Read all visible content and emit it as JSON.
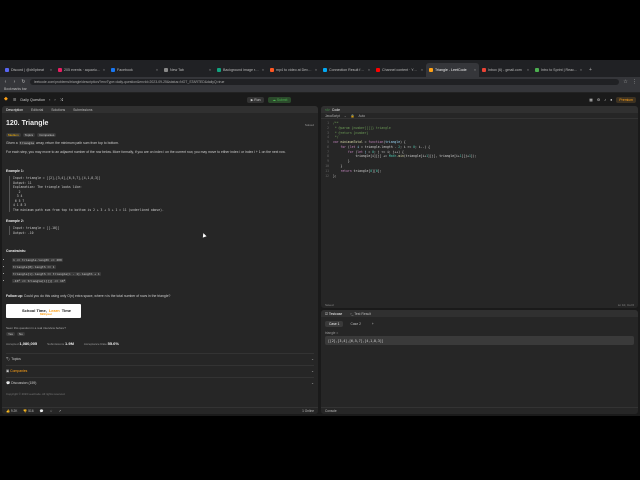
{
  "browser": {
    "tabs": [
      {
        "label": "Discord | @dr0pbeat",
        "color": "#5865f2",
        "active": false
      },
      {
        "label": "205 events · aquarius | Fr...",
        "color": "#e91e63",
        "active": false
      },
      {
        "label": "Facebook",
        "color": "#1877f2",
        "active": false
      },
      {
        "label": "New Tab",
        "color": "#888888",
        "active": false
      },
      {
        "label": "Background image request",
        "color": "#10a37f",
        "active": false
      },
      {
        "label": "mp4 to video at DevSkills5",
        "color": "#ff5722",
        "active": false
      },
      {
        "label": "Connection Result for #Wi...",
        "color": "#03a9f4",
        "active": false
      },
      {
        "label": "Channel content · YouTube",
        "color": "#ff0000",
        "active": false
      },
      {
        "label": "Triangle - LeetCode",
        "color": "#ffa116",
        "active": true
      },
      {
        "label": "Inbox (6) - gmail.com",
        "color": "#ea4335",
        "active": false
      },
      {
        "label": "Intro to Sprint | ReactJobs",
        "color": "#4caf50",
        "active": false
      }
    ],
    "url": "leetcode.com/problems/triangle/description/?envType=daily-question&envId=2023-09-25&status=NOT_STARTED&dailyQ=true",
    "bookmarks": [
      "Bookmarks bar"
    ]
  },
  "header": {
    "daily_label": "Daily Question",
    "run_label": "Run",
    "submit_label": "Submit",
    "premium_label": "Premium"
  },
  "left": {
    "tabs": [
      "Description",
      "Editorial",
      "Solutions",
      "Submissions"
    ],
    "title": "120. Triangle",
    "solved": "Solved",
    "badges": [
      "Medium",
      "Topics",
      "Companies"
    ],
    "desc1_pre": "Given a",
    "desc1_code": "triangle",
    "desc1_post": "array, return the minimum path sum from top to bottom.",
    "desc2": "For each step, you may move to an adjacent number of the row below. More formally, if you are on index i on the current row, you may move to either index i or index i + 1 on the next row.",
    "ex1_title": "Example 1:",
    "ex1_block": "Input: triangle = [[2],[3,4],[6,5,7],[4,1,8,3]]\nOutput: 11\nExplanation: The triangle looks like:\n   2\n  3 4\n 6 5 7\n4 1 8 3\nThe minimum path sum from top to bottom is 2 + 3 + 5 + 1 = 11 (underlined above).",
    "ex2_title": "Example 2:",
    "ex2_block": "Input: triangle = [[-10]]\nOutput: -10",
    "cons_title": "Constraints:",
    "constraints": [
      "1 <= triangle.length <= 200",
      "triangle[0].length == 1",
      "triangle[i].length == triangle[i - 1].length + 1",
      "-10⁴ <= triangle[i][j] <= 10⁴"
    ],
    "followup_label": "Follow up:",
    "followup": "Could you do this using only O(n) extra space, where n is the total number of rows in the triangle?",
    "banner_a": "School Time,",
    "banner_hl": "Learn",
    "banner_b": "Time",
    "banner_sub": "$99/year",
    "seen_q": "Seen this question in a real interview before?",
    "yes": "Yes",
    "no": "No",
    "accepted_label": "Accepted",
    "accepted": "1,080,005",
    "subs_label": "Submissions",
    "subs": "1.9M",
    "rate_label": "Acceptance Rate",
    "rate": "55.6%",
    "sections": [
      "Topics",
      "Companies",
      "Discussion (159)"
    ],
    "copyright": "Copyright © 2023 LeetCode. All rights reserved.",
    "footer_likes": "9.2K",
    "footer_dislikes": "516",
    "footer_online": "1 Online"
  },
  "code": {
    "tab_label": "Code",
    "lang": "JavaScript",
    "mode": "Auto",
    "status_left": "Saved",
    "status_right": "Ln 10, Col 6"
  },
  "test": {
    "tabs": [
      "Testcase",
      "Test Result"
    ],
    "cases": [
      "Case 1",
      "Case 2"
    ],
    "label": "triangle =",
    "value": "[[2],[3,4],[6,5,7],[4,1,8,3]]",
    "footer": "Console"
  }
}
